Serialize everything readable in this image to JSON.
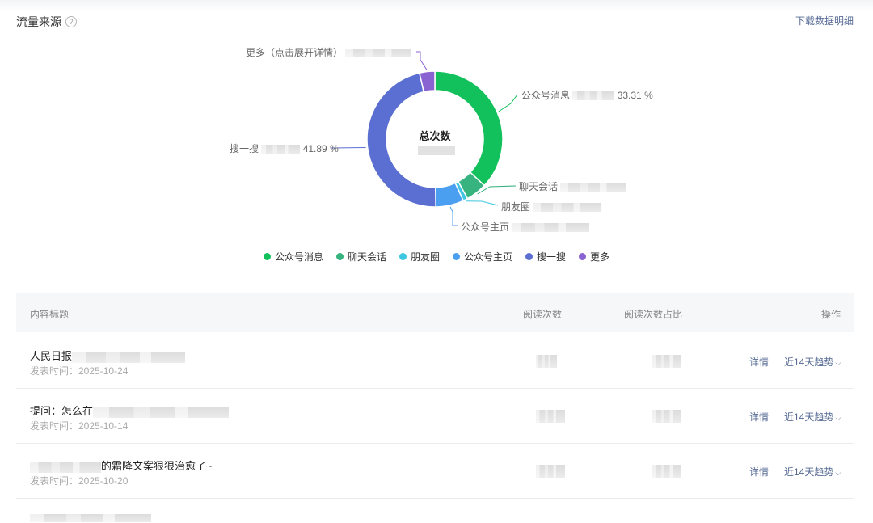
{
  "header": {
    "title": "流量来源",
    "help_icon": "?",
    "download_label": "下载数据明细"
  },
  "chart_data": {
    "type": "pie",
    "center_label": "总次数",
    "categories": [
      "公众号消息",
      "聊天会话",
      "朋友圈",
      "公众号主页",
      "搜一搜",
      "更多"
    ],
    "values": [
      33.31,
      4.5,
      1.0,
      6.0,
      41.89,
      3.3
    ],
    "printed_percentages": {
      "公众号消息": "33.31 %",
      "搜一搜": "41.89 %"
    },
    "colors": [
      "#12c15b",
      "#36b37e",
      "#3fc6e0",
      "#4a9ff0",
      "#5b6ed1",
      "#8a63d2"
    ],
    "legend_position": "bottom"
  },
  "callouts": {
    "msg": {
      "label": "公众号消息",
      "pct": "33.31 %"
    },
    "chat": {
      "label": "聊天会话"
    },
    "moments": {
      "label": "朋友圈"
    },
    "home": {
      "label": "公众号主页"
    },
    "search": {
      "label": "搜一搜",
      "pct": "41.89 %"
    },
    "more": {
      "label": "更多（点击展开详情）"
    }
  },
  "legend": [
    "公众号消息",
    "聊天会话",
    "朋友圈",
    "公众号主页",
    "搜一搜",
    "更多"
  ],
  "table": {
    "columns": [
      "内容标题",
      "阅读次数",
      "阅读次数占比",
      "操作"
    ],
    "rows": [
      {
        "title": "人民日报",
        "time": "发表时间：2025-10-24",
        "detail": "详情",
        "trend": "近14天趋势"
      },
      {
        "title": "提问：怎么在",
        "time": "发表时间：2025-10-14",
        "detail": "详情",
        "trend": "近14天趋势"
      },
      {
        "title": "的霜降文案狠狠治愈了~",
        "time": "发表时间：2025-10-20",
        "detail": "详情",
        "trend": "近14天趋势"
      }
    ]
  }
}
